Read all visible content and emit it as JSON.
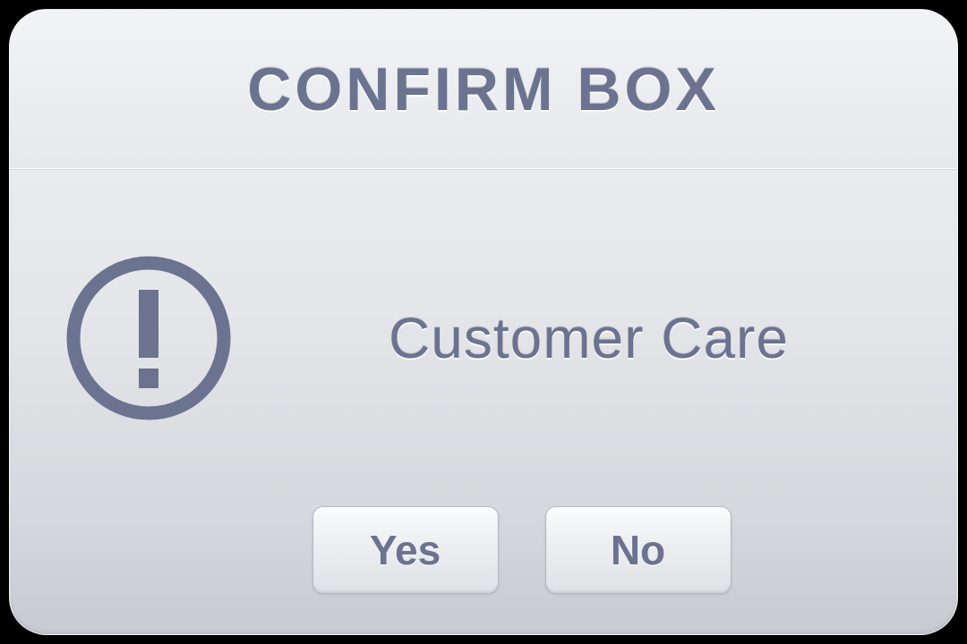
{
  "dialog": {
    "title": "CONFIRM BOX",
    "message": "Customer Care",
    "icon": "alert-circle",
    "buttons": {
      "yes_label": "Yes",
      "no_label": "No"
    }
  }
}
